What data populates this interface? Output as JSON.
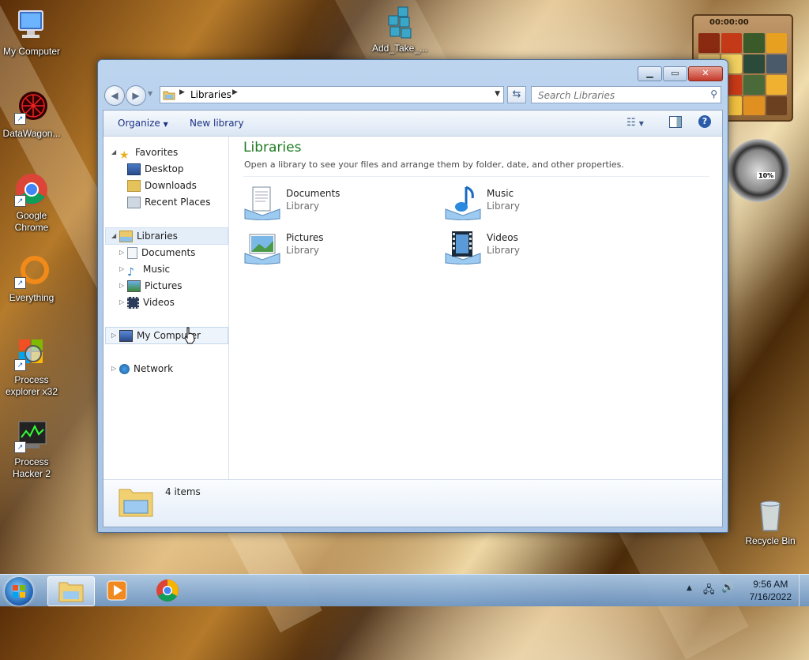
{
  "desktop": {
    "icons": [
      {
        "label": "My Computer"
      },
      {
        "label": "DataWagon..."
      },
      {
        "label": "Google Chrome"
      },
      {
        "label": "Everything"
      },
      {
        "label": "Process explorer x32"
      },
      {
        "label": "Process Hacker 2"
      },
      {
        "label": "Add_Take_..."
      },
      {
        "label": "Recycle Bin"
      }
    ]
  },
  "gadgets": {
    "puzzle_timer": "00:00:00",
    "cpu_meter_value": "10%"
  },
  "window": {
    "address": {
      "segments": [
        "Libraries"
      ],
      "refresh_icon": "refresh-icon",
      "dropdown_icon": "chevron-down-icon"
    },
    "search": {
      "placeholder": "Search Libraries"
    },
    "toolbar": {
      "organize_label": "Organize",
      "new_library_label": "New library"
    },
    "nav_pane": {
      "favorites": {
        "label": "Favorites",
        "items": [
          "Desktop",
          "Downloads",
          "Recent Places"
        ]
      },
      "libraries": {
        "label": "Libraries",
        "items": [
          "Documents",
          "Music",
          "Pictures",
          "Videos"
        ]
      },
      "computer_label": "My Computer",
      "network_label": "Network"
    },
    "main": {
      "title": "Libraries",
      "description": "Open a library to see your files and arrange them by folder, date, and other properties.",
      "libraries": [
        {
          "name": "Documents",
          "type": "Library",
          "icon": "documents-library-icon"
        },
        {
          "name": "Music",
          "type": "Library",
          "icon": "music-library-icon"
        },
        {
          "name": "Pictures",
          "type": "Library",
          "icon": "pictures-library-icon"
        },
        {
          "name": "Videos",
          "type": "Library",
          "icon": "videos-library-icon"
        }
      ]
    },
    "details": {
      "item_count": "4 items"
    }
  },
  "taskbar": {
    "clock_time": "9:56 AM",
    "clock_date": "7/16/2022",
    "items": [
      "explorer",
      "media-player",
      "chrome"
    ]
  },
  "colors": {
    "title_green": "#1e7a22",
    "link_blue": "#1e3287",
    "selection_blue": "#dbe9f8"
  }
}
